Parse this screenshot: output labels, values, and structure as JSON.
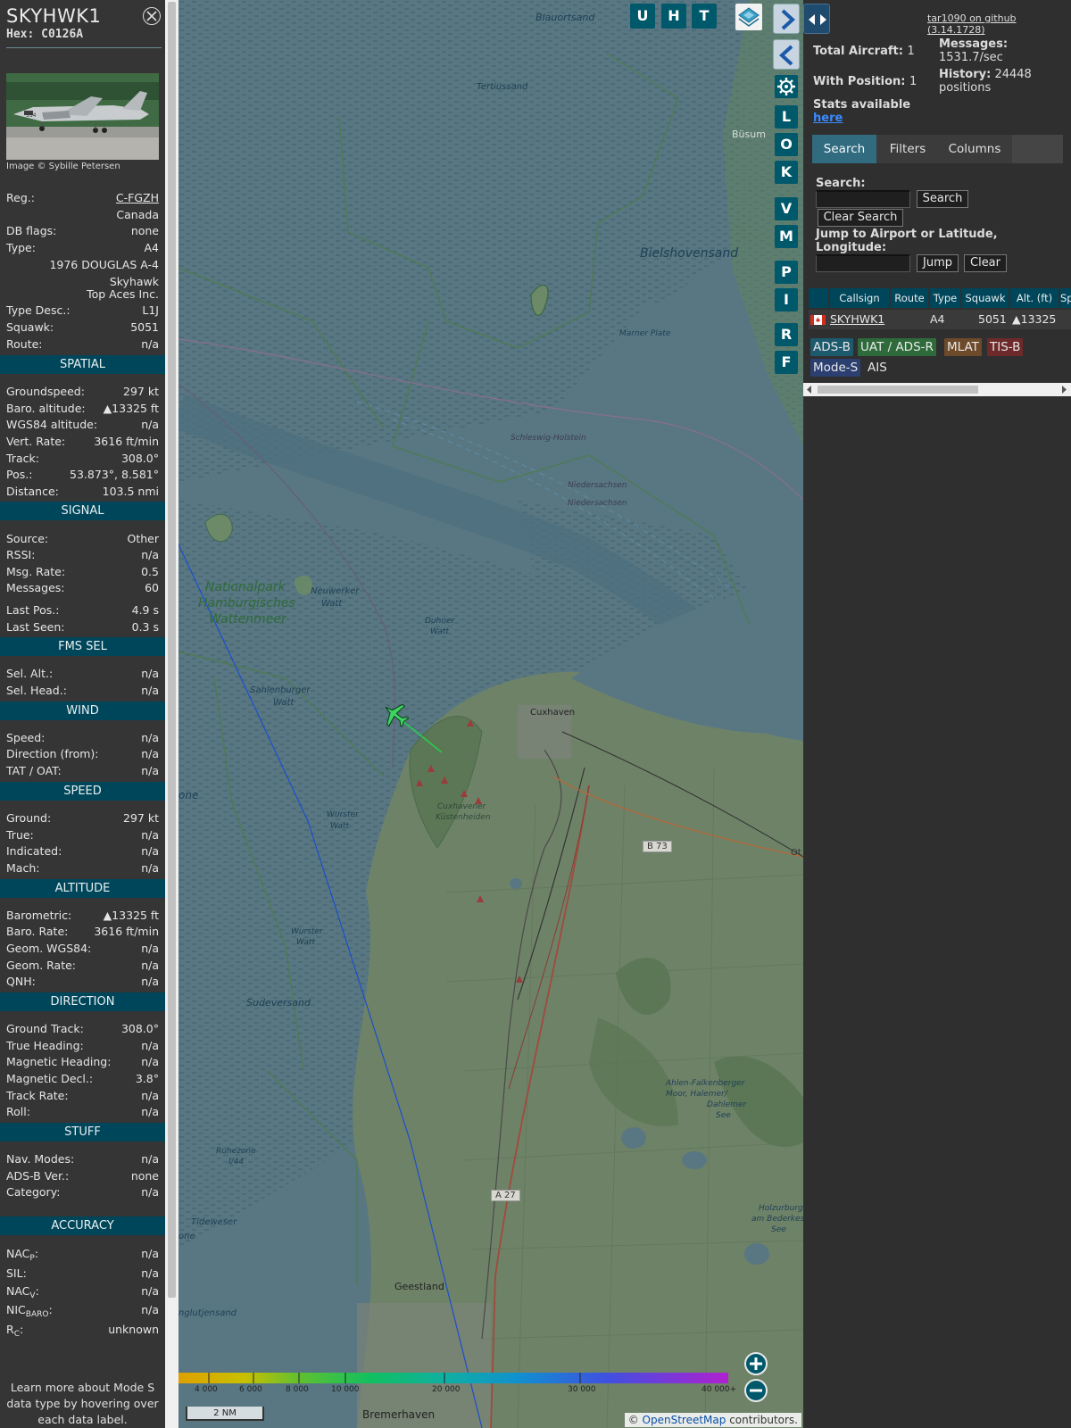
{
  "aircraft": {
    "callsign": "SKYHWK1",
    "hex_label": "Hex:",
    "hex": "C0126A",
    "photo_credit": "Image © Sybille Petersen"
  },
  "details": {
    "reg": {
      "label": "Reg.:",
      "value": "C-FGZH",
      "country": "Canada"
    },
    "db_flags": {
      "label": "DB flags:",
      "value": "none"
    },
    "type": {
      "label": "Type:",
      "value": "A4"
    },
    "type_name_1": "1976 DOUGLAS A-4",
    "type_name_2": "Skyhawk",
    "operator": "Top Aces Inc.",
    "type_desc": {
      "label": "Type Desc.:",
      "value": "L1J"
    },
    "squawk": {
      "label": "Squawk:",
      "value": "5051"
    },
    "route": {
      "label": "Route:",
      "value": "n/a"
    }
  },
  "sections": [
    {
      "title": "SPATIAL",
      "rows": [
        {
          "label": "Groundspeed:",
          "value": "297 kt"
        },
        {
          "label": "Baro. altitude:",
          "value": "▲13325 ft"
        },
        {
          "label": "WGS84 altitude:",
          "value": "n/a"
        },
        {
          "label": "Vert. Rate:",
          "value": "3616 ft/min"
        },
        {
          "label": "Track:",
          "value": "308.0°"
        },
        {
          "label": "Pos.:",
          "value": "53.873°, 8.581°"
        },
        {
          "label": "Distance:",
          "value": "103.5 nmi"
        }
      ]
    },
    {
      "title": "SIGNAL",
      "rows": [
        {
          "label": "Source:",
          "value": "Other"
        },
        {
          "label": "RSSI:",
          "value": "n/a"
        },
        {
          "label": "Msg. Rate:",
          "value": "0.5"
        },
        {
          "label": "Messages:",
          "value": "60"
        },
        {
          "label": "Last Pos.:",
          "value": "4.9 s"
        },
        {
          "label": "Last Seen:",
          "value": "0.3 s"
        }
      ]
    },
    {
      "title": "FMS SEL",
      "rows": [
        {
          "label": "Sel. Alt.:",
          "value": "n/a"
        },
        {
          "label": "Sel. Head.:",
          "value": "n/a"
        }
      ]
    },
    {
      "title": "WIND",
      "rows": [
        {
          "label": "Speed:",
          "value": "n/a"
        },
        {
          "label": "Direction (from):",
          "value": "n/a"
        },
        {
          "label": "TAT / OAT:",
          "value": "n/a"
        }
      ]
    },
    {
      "title": "SPEED",
      "rows": [
        {
          "label": "Ground:",
          "value": "297 kt"
        },
        {
          "label": "True:",
          "value": "n/a"
        },
        {
          "label": "Indicated:",
          "value": "n/a"
        },
        {
          "label": "Mach:",
          "value": "n/a"
        }
      ]
    },
    {
      "title": "ALTITUDE",
      "rows": [
        {
          "label": "Barometric:",
          "value": "▲13325 ft"
        },
        {
          "label": "Baro. Rate:",
          "value": "3616 ft/min"
        },
        {
          "label": "Geom. WGS84:",
          "value": "n/a"
        },
        {
          "label": "Geom. Rate:",
          "value": "n/a"
        },
        {
          "label": "QNH:",
          "value": "n/a"
        }
      ]
    },
    {
      "title": "DIRECTION",
      "rows": [
        {
          "label": "Ground Track:",
          "value": "308.0°"
        },
        {
          "label": "True Heading:",
          "value": "n/a"
        },
        {
          "label": "Magnetic Heading:",
          "value": "n/a"
        },
        {
          "label": "Magnetic Decl.:",
          "value": "3.8°"
        },
        {
          "label": "Track Rate:",
          "value": "n/a"
        },
        {
          "label": "Roll:",
          "value": "n/a"
        }
      ]
    },
    {
      "title": "STUFF",
      "rows": [
        {
          "label": "Nav. Modes:",
          "value": "n/a"
        },
        {
          "label": "ADS-B Ver.:",
          "value": "none"
        },
        {
          "label": "Category:",
          "value": "n/a"
        }
      ]
    },
    {
      "title": "ACCURACY",
      "rows": [
        {
          "label": "NAC",
          "sub": "P",
          "value": "n/a"
        },
        {
          "label": "SIL:",
          "value": "n/a"
        },
        {
          "label": "NAC",
          "sub": "V",
          "value": "n/a"
        },
        {
          "label": "NIC",
          "sub": "BARO",
          "value": "n/a"
        },
        {
          "label": "R",
          "sub": "C",
          "value": "unknown"
        }
      ]
    }
  ],
  "learn_more": "Learn more about Mode S data type by hovering over each data label.",
  "map": {
    "buttons_top": [
      "U",
      "H",
      "T"
    ],
    "buttons_side": [
      "L",
      "O",
      "K",
      "V",
      "M",
      "P",
      "I",
      "R",
      "F"
    ],
    "labels": [
      {
        "text": "Blauortsand"
      },
      {
        "text": "Tertiussand"
      },
      {
        "text": "Büsum"
      },
      {
        "text": "Bielshovensand"
      },
      {
        "text": "Marner Plate"
      },
      {
        "text": "Schleswig-Holstein"
      },
      {
        "text": "Niedersachsen"
      },
      {
        "text": "Niedersachsen"
      },
      {
        "text": "Nationalpark"
      },
      {
        "text": "Hamburgisches"
      },
      {
        "text": "Wattenmeer"
      },
      {
        "text": "Neuwerker"
      },
      {
        "text": "Watt"
      },
      {
        "text": "Duhner"
      },
      {
        "text": "Watt"
      },
      {
        "text": "Sahlenburger"
      },
      {
        "text": "Watt"
      },
      {
        "text": "Cuxhaven"
      },
      {
        "text": "Cuxhavener"
      },
      {
        "text": "Küstenheiden"
      },
      {
        "text": "Wurster"
      },
      {
        "text": "Watt"
      },
      {
        "text": "Wurster"
      },
      {
        "text": "Watt"
      },
      {
        "text": "Sudeversand"
      },
      {
        "text": "B 73"
      },
      {
        "text": "Ahlen-Falkenberger"
      },
      {
        "text": "Moor, Halemer/"
      },
      {
        "text": "Dahlemer"
      },
      {
        "text": "See"
      },
      {
        "text": "Ruhezone"
      },
      {
        "text": "I/44"
      },
      {
        "text": "A 27"
      },
      {
        "text": "Holzurburg"
      },
      {
        "text": "am Bederkese"
      },
      {
        "text": "See"
      },
      {
        "text": "Tideweser"
      },
      {
        "text": "Geestland"
      },
      {
        "text": "Bremerhaven"
      },
      {
        "text": "one"
      },
      {
        "text": "one"
      },
      {
        "text": "Ot"
      },
      {
        "text": "nglutjensand"
      }
    ],
    "altitude_ticks": [
      "4 000",
      "6 000",
      "8 000",
      "10 000",
      "20 000",
      "30 000",
      "40 000+"
    ],
    "scale_label": "2 NM",
    "attribution_prefix": "© ",
    "attribution_link": "OpenStreetMap",
    "attribution_suffix": " contributors."
  },
  "sidebar": {
    "github_link": "tar1090 on github (3.14.1728)",
    "total_aircraft_label": "Total Aircraft:",
    "total_aircraft": "1",
    "with_position_label": "With Position:",
    "with_position": "1",
    "messages_label": "Messages:",
    "messages_value": "1531.7/sec",
    "history_label": "History:",
    "history_value_1": "24448",
    "history_value_2": "positions",
    "stats_label": "Stats available",
    "stats_link": "here",
    "tabs": [
      "Search",
      "Filters",
      "Columns"
    ],
    "search_label": "Search:",
    "search_button": "Search",
    "clear_search_button": "Clear Search",
    "jump_label_1": "Jump to Airport or Latitude,",
    "jump_label_2": "Longitude:",
    "jump_button": "Jump",
    "clear_button": "Clear",
    "table": {
      "columns": [
        "Callsign",
        "Route",
        "Type",
        "Squawk",
        "Alt. (ft)",
        "Sp"
      ],
      "rows": [
        {
          "callsign": "SKYHWK1",
          "route": "",
          "type": "A4",
          "squawk": "5051",
          "alt": "▲13325"
        }
      ]
    },
    "sources": [
      {
        "label": "ADS-B",
        "bg": "#1d5a6e"
      },
      {
        "label": "UAT / ADS-R",
        "bg": "#2f6b3a"
      },
      {
        "label": "MLAT",
        "bg": "#6d4a2a"
      },
      {
        "label": "TIS-B",
        "bg": "#6e2a2a"
      },
      {
        "label": "Mode-S",
        "bg": "#2b3f70"
      },
      {
        "label": "AIS",
        "bg": ""
      }
    ]
  }
}
